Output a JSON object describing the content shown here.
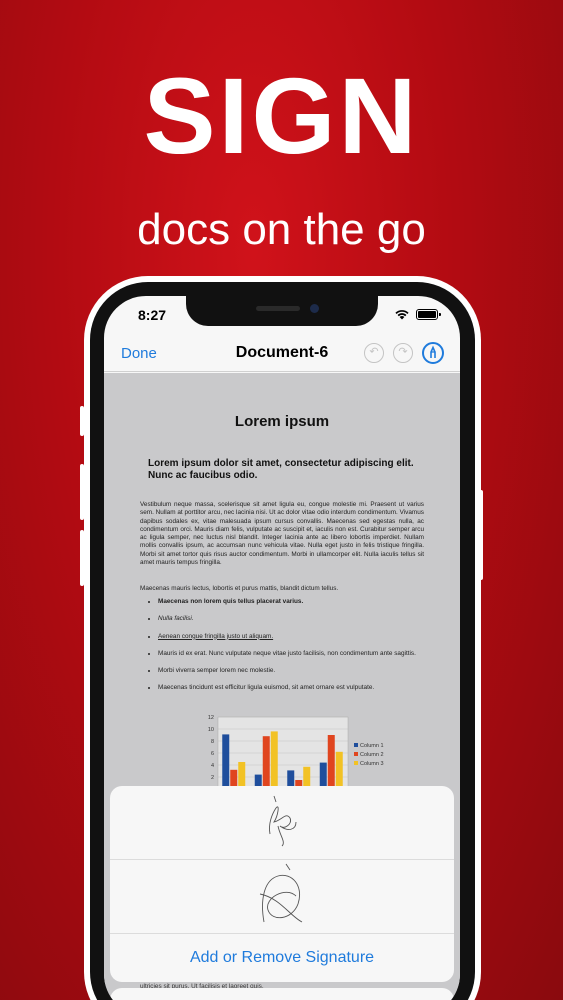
{
  "marketing": {
    "headline": "SIGN",
    "subline": "docs on the go"
  },
  "status_bar": {
    "time": "8:27"
  },
  "navbar": {
    "done_label": "Done",
    "title": "Document-6"
  },
  "document": {
    "title": "Lorem ipsum",
    "heading": "Lorem ipsum dolor sit amet, consectetur adipiscing elit. Nunc ac faucibus odio.",
    "paragraph1": "Vestibulum neque massa, scelerisque sit amet ligula eu, congue molestie mi. Praesent ut varius sem. Nullam at porttitor arcu, nec lacinia nisi. Ut ac dolor vitae odio interdum condimentum. Vivamus dapibus sodales ex, vitae malesuada ipsum cursus convallis. Maecenas sed egestas nulla, ac condimentum orci. Mauris diam felis, vulputate ac suscipit et, iaculis non est. Curabitur semper arcu ac ligula semper, nec luctus nisl blandit. Integer lacinia ante ac libero lobortis imperdiet. Nullam mollis convallis ipsum, ac accumsan nunc vehicula vitae. Nulla eget justo in felis tristique fringilla. Morbi sit amet tortor quis risus auctor condimentum. Morbi in ullamcorper elit. Nulla iaculis tellus sit amet mauris tempus fringilla.",
    "paragraph2": "Maecenas mauris lectus, lobortis et purus mattis, blandit dictum tellus.",
    "list": [
      "Maecenas non lorem quis tellus placerat varius.",
      "Nulla facilisi.",
      "Aenean congue fringilla justo ut aliquam.",
      "Mauris id ex erat. Nunc vulputate neque vitae justo facilisis, non condimentum ante sagittis.",
      "Morbi viverra semper lorem nec molestie.",
      "Maecenas tincidunt est efficitur ligula euismod, sit amet ornare est vulputate."
    ],
    "footer_text": "ultricies sit purus. Ut facilisis et laoreet quis."
  },
  "chart_data": {
    "type": "bar",
    "categories": [
      "1",
      "2",
      "3",
      "4"
    ],
    "series": [
      {
        "name": "Column 1",
        "values": [
          9.1,
          2.4,
          3.1,
          4.4
        ],
        "color": "#1f4e9c"
      },
      {
        "name": "Column 2",
        "values": [
          3.2,
          8.8,
          1.5,
          9.0
        ],
        "color": "#e0451f"
      },
      {
        "name": "Column 3",
        "values": [
          4.5,
          9.6,
          3.7,
          6.2
        ],
        "color": "#f2c224"
      }
    ],
    "yticks": [
      "12",
      "10",
      "8",
      "6",
      "4",
      "2"
    ],
    "ylim": [
      0,
      12
    ],
    "legend_position": "right"
  },
  "sheet": {
    "action_label": "Add or Remove Signature"
  },
  "colors": {
    "accent": "#1f7bdc",
    "brand_red": "#c0101a"
  }
}
